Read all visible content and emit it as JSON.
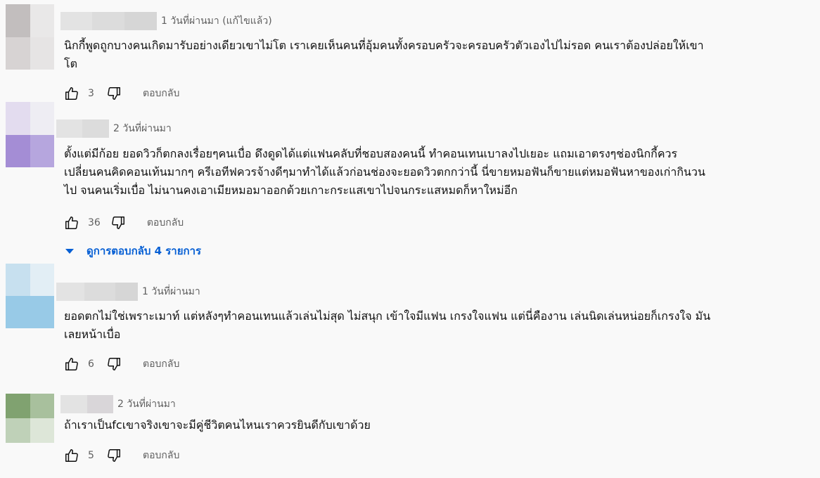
{
  "comments": [
    {
      "time": "1 วันที่ผ่านมา (แก้ไขแล้ว)",
      "text": "นิกกี้พูดถูกบางคนเกิดมารับอย่างเดียวเขาไม่โต เราเคยเห็นคนที่อุ้มคนทั้งครอบครัวจะครอบครัวตัวเองไปไม่รอด คนเราต้องปล่อยให้เขา\nโต",
      "likes": "3",
      "reply_label": "ตอบกลับ",
      "avatar_colors": [
        "#c2bebe",
        "#e9e8e8",
        "#d7d3d3",
        "#e6e4e4"
      ]
    },
    {
      "time": "2 วันที่ผ่านมา",
      "text": "ตั้งแต่มีก้อย ยอดวิวก็ตกลงเรื่อยๆคนเบื่อ ดึงดูดได้แต่แฟนคลับที่ชอบสองคนนี้ ทำคอนเทนเบาลงไปเยอะ แถมเอาตรงๆช่องนิกกี้ควร\nเปลี่ยนคนคิดคอนเท้นมากๆ ครีเอทีฟควรจ้างดีๆมาทำได้แล้วก่อนช่องจะยอดวิวตกกว่านี้ นี่ขายหมอฟันก็ขายแต่หมอฟันหาของเก่ากินวน\nไป จนคนเริ่มเบื่อ ไม่นานคงเอาเมียหมอมาออกด้วยเกาะกระแสเขาไปจนกระแสหมดก็หาใหม่อีก",
      "likes": "36",
      "reply_label": "ตอบกลับ",
      "avatar_colors": [
        "#e3dcef",
        "#eeedf3",
        "#a48dd5",
        "#b6a6de"
      ]
    },
    {
      "time": "1 วันที่ผ่านมา",
      "text": "ยอดตกไม่ใช่เพราะเมาท์ แต่หลังๆทำคอนเทนแล้วเล่นไม่สุด ไม่สนุก เข้าใจมีแฟน เกรงใจแฟน แต่นี่คืองาน เล่นนิดเล่นหน่อยก็เกรงใจ มัน\nเลยหน้าเบื่อ",
      "likes": "6",
      "reply_label": "ตอบกลับ",
      "avatar_colors": [
        "#c7e0ef",
        "#e2eef5",
        "#98cae7",
        "#98cae7"
      ]
    },
    {
      "time": "2 วันที่ผ่านมา",
      "text": "ถ้าเราเป็นfcเขาจริงเขาจะมีคู่ชีวิตคนไหนเราควรยินดีกับเขาด้วย",
      "likes": "5",
      "reply_label": "ตอบกลับ",
      "avatar_colors": [
        "#80a270",
        "#a8c09d",
        "#bfd1b8",
        "#dde6d8"
      ]
    }
  ],
  "replies_toggle": {
    "label": "ดูการตอบกลับ 4 รายการ",
    "color": "#065fd4"
  },
  "icons": {
    "like": "thumbs-up-icon",
    "dislike": "thumbs-down-icon",
    "expand": "caret-down-icon"
  }
}
